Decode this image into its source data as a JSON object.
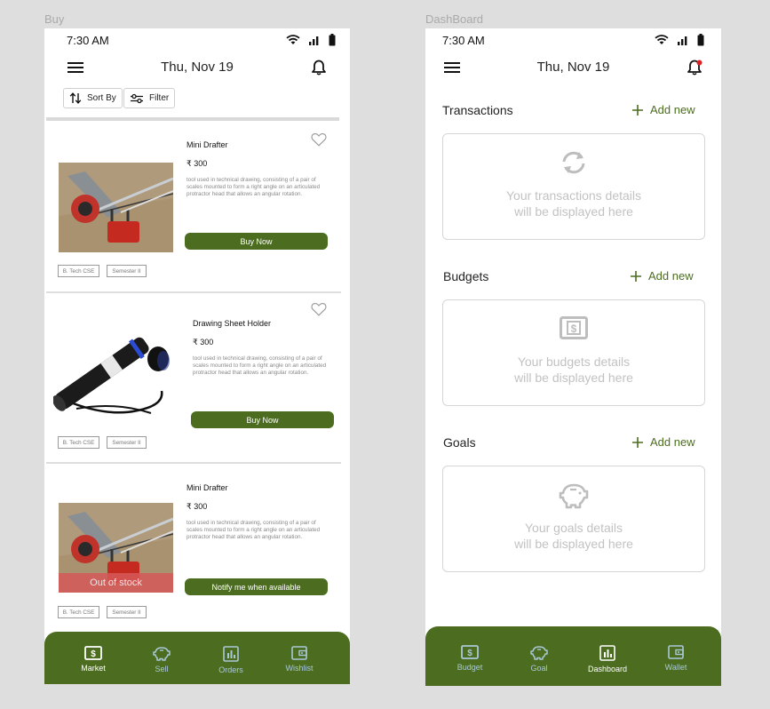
{
  "frames": {
    "buy": "Buy",
    "dashboard": "DashBoard"
  },
  "buy": {
    "status_time": "7:30 AM",
    "date": "Thu, Nov 19",
    "sort_label": "Sort By",
    "filter_label": "Filter",
    "products": [
      {
        "name": "Mini Drafter",
        "price": "₹ 300",
        "description": "tool used in technical drawing, consisting of a pair of scales mounted to form a right angle on an articulated protractor head that allows an angular rotation.",
        "action": "Buy Now",
        "tags": [
          "B. Tech CSE",
          "Semester II"
        ],
        "out_of_stock": ""
      },
      {
        "name": "Drawing Sheet Holder",
        "price": "₹ 300",
        "description": "tool used in technical drawing, consisting of a pair of scales mounted to form a right angle on an articulated protractor head that allows an angular rotation.",
        "action": "Buy Now",
        "tags": [
          "B. Tech CSE",
          "Semester II"
        ],
        "out_of_stock": ""
      },
      {
        "name": "Mini Drafter",
        "price": "₹ 300",
        "description": "tool used in technical drawing, consisting of a pair of scales mounted to form a right angle on an articulated protractor head that allows an angular rotation.",
        "action": "Notify me when available",
        "tags": [
          "B. Tech CSE",
          "Semester II"
        ],
        "out_of_stock": "Out of stock"
      }
    ],
    "nav": [
      {
        "label": "Market",
        "icon": "dollar-card-icon",
        "active": true
      },
      {
        "label": "Sell",
        "icon": "piggy-bank-icon",
        "active": false
      },
      {
        "label": "Orders",
        "icon": "bar-chart-icon",
        "active": false
      },
      {
        "label": "Wishlist",
        "icon": "wallet-icon",
        "active": false
      }
    ]
  },
  "dashboard": {
    "status_time": "7:30 AM",
    "date": "Thu, Nov 19",
    "sections": [
      {
        "title": "Transactions",
        "add_label": "Add new",
        "line1": "Your transactions details",
        "line2": "will be displayed here",
        "icon": "sync-icon"
      },
      {
        "title": "Budgets",
        "add_label": "Add new",
        "line1": "Your budgets details",
        "line2": "will be displayed here",
        "icon": "dollar-card-icon"
      },
      {
        "title": "Goals",
        "add_label": "Add new",
        "line1": "Your goals details",
        "line2": "will be displayed here",
        "icon": "piggy-bank-icon"
      }
    ],
    "nav": [
      {
        "label": "Budget",
        "icon": "dollar-card-icon",
        "active": false
      },
      {
        "label": "Goal",
        "icon": "piggy-bank-icon",
        "active": false
      },
      {
        "label": "Dashboard",
        "icon": "bar-chart-icon",
        "active": true
      },
      {
        "label": "Wallet",
        "icon": "wallet-icon",
        "active": false
      }
    ]
  },
  "colors": {
    "brand_green": "#4c6d20",
    "out_of_stock": "#d55858",
    "inactive_nav": "#a9c8d8",
    "notification_dot": "#e02020"
  }
}
